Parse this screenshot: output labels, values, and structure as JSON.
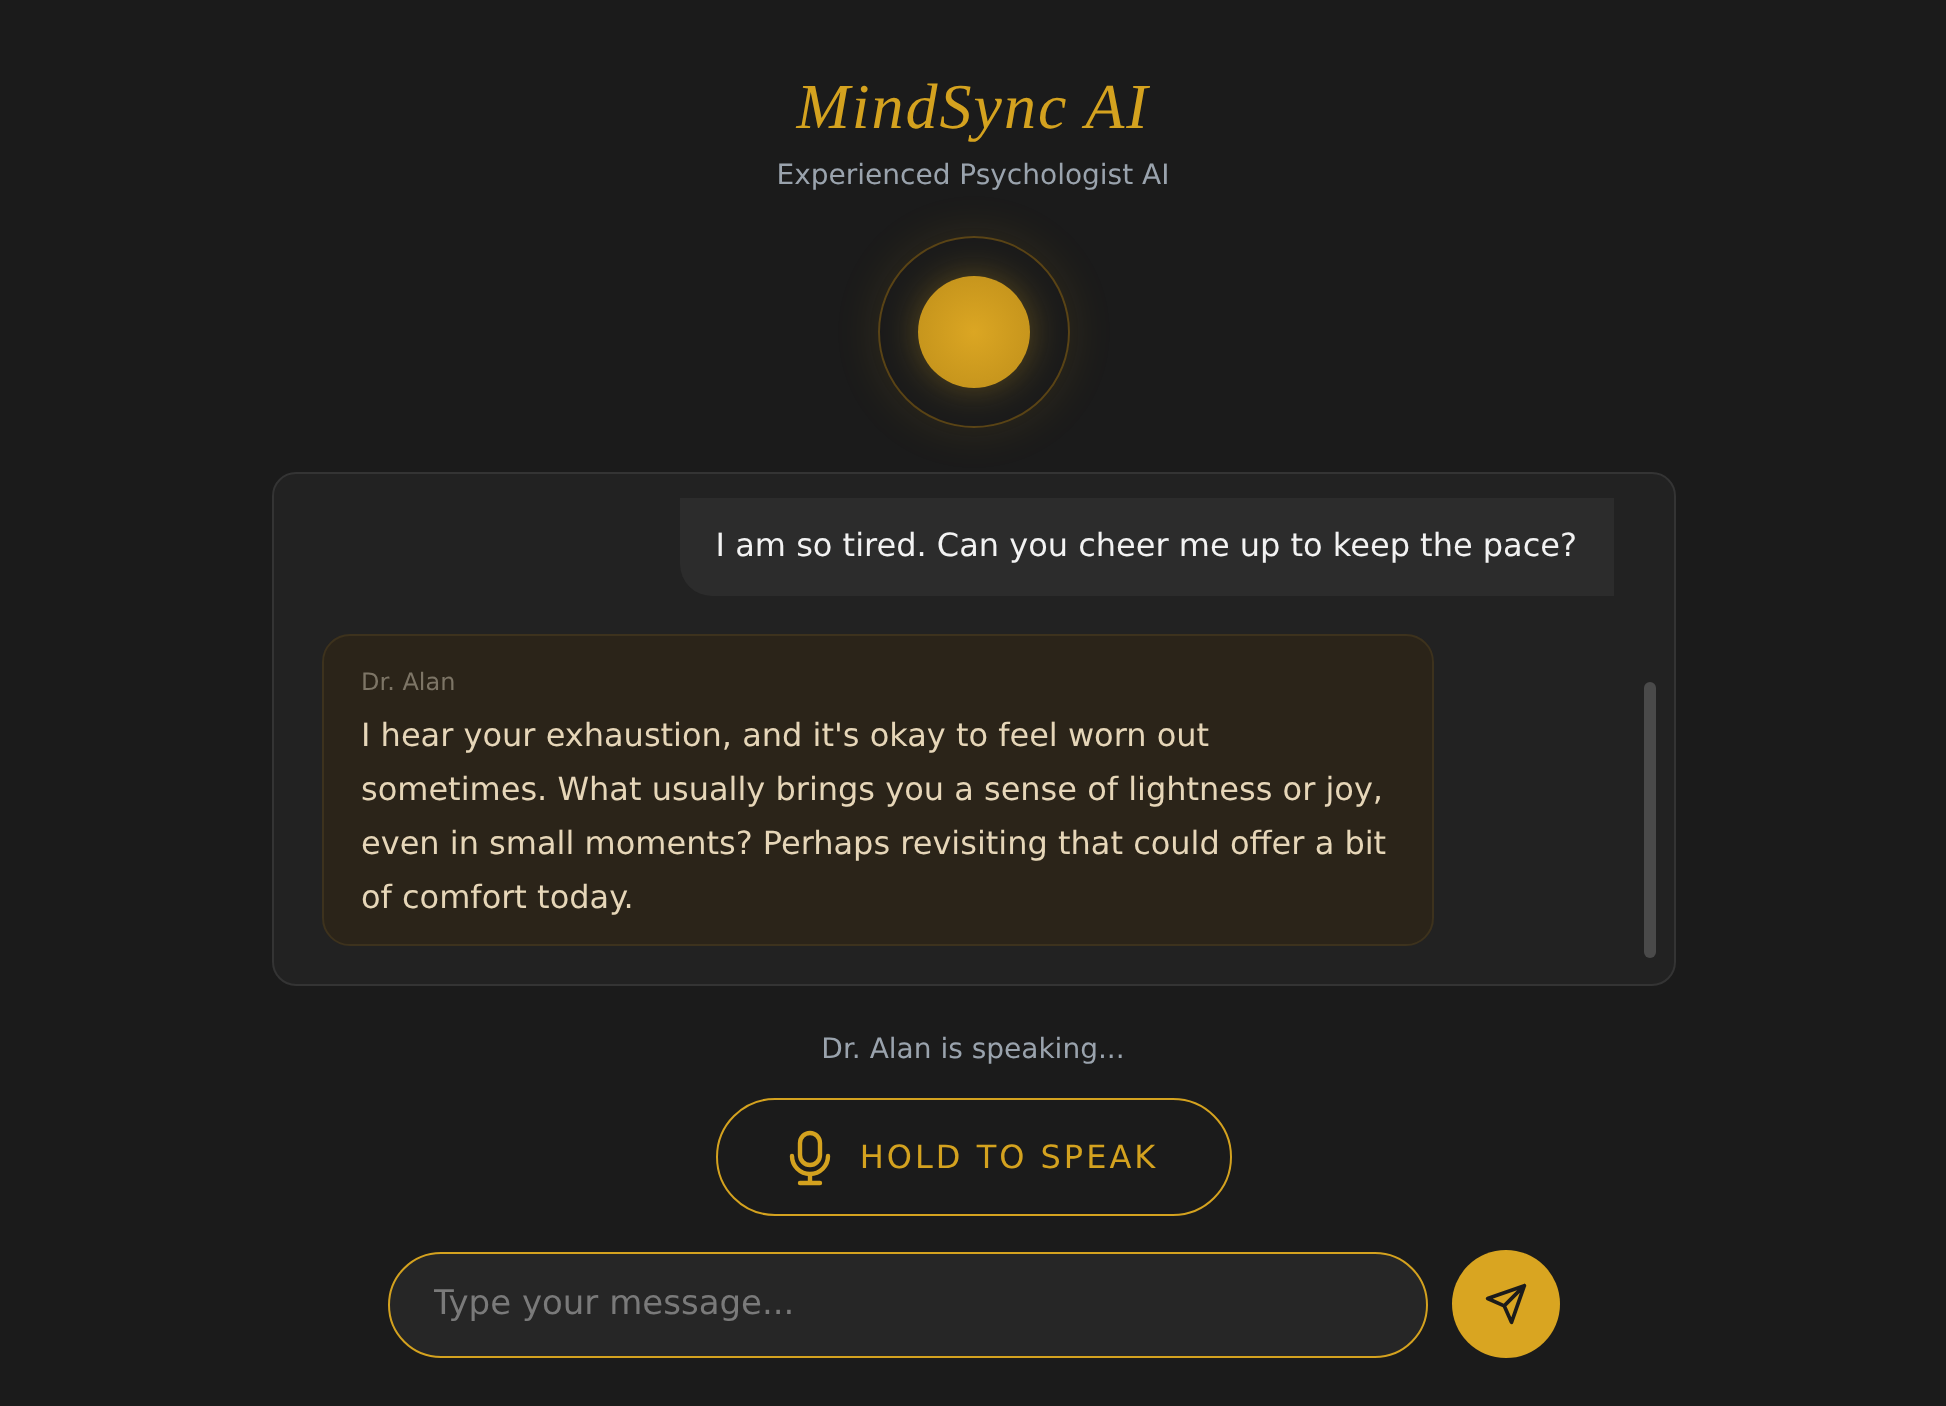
{
  "header": {
    "title": "MindSync AI",
    "subtitle": "Experienced Psychologist AI"
  },
  "messages": [
    {
      "kind": "user",
      "text": "I am so tired. Can you cheer me up to keep the pace?"
    },
    {
      "kind": "assistant",
      "sender": "Dr. Alan",
      "text": "I hear your exhaustion, and it's okay to feel worn out sometimes. What usually brings you a sense of lightness or joy, even in small moments? Perhaps revisiting that could offer a bit of comfort today."
    }
  ],
  "status": "Dr. Alan is speaking...",
  "voice_button": {
    "label": "HOLD TO SPEAK"
  },
  "composer": {
    "placeholder": "Type your message..."
  }
}
